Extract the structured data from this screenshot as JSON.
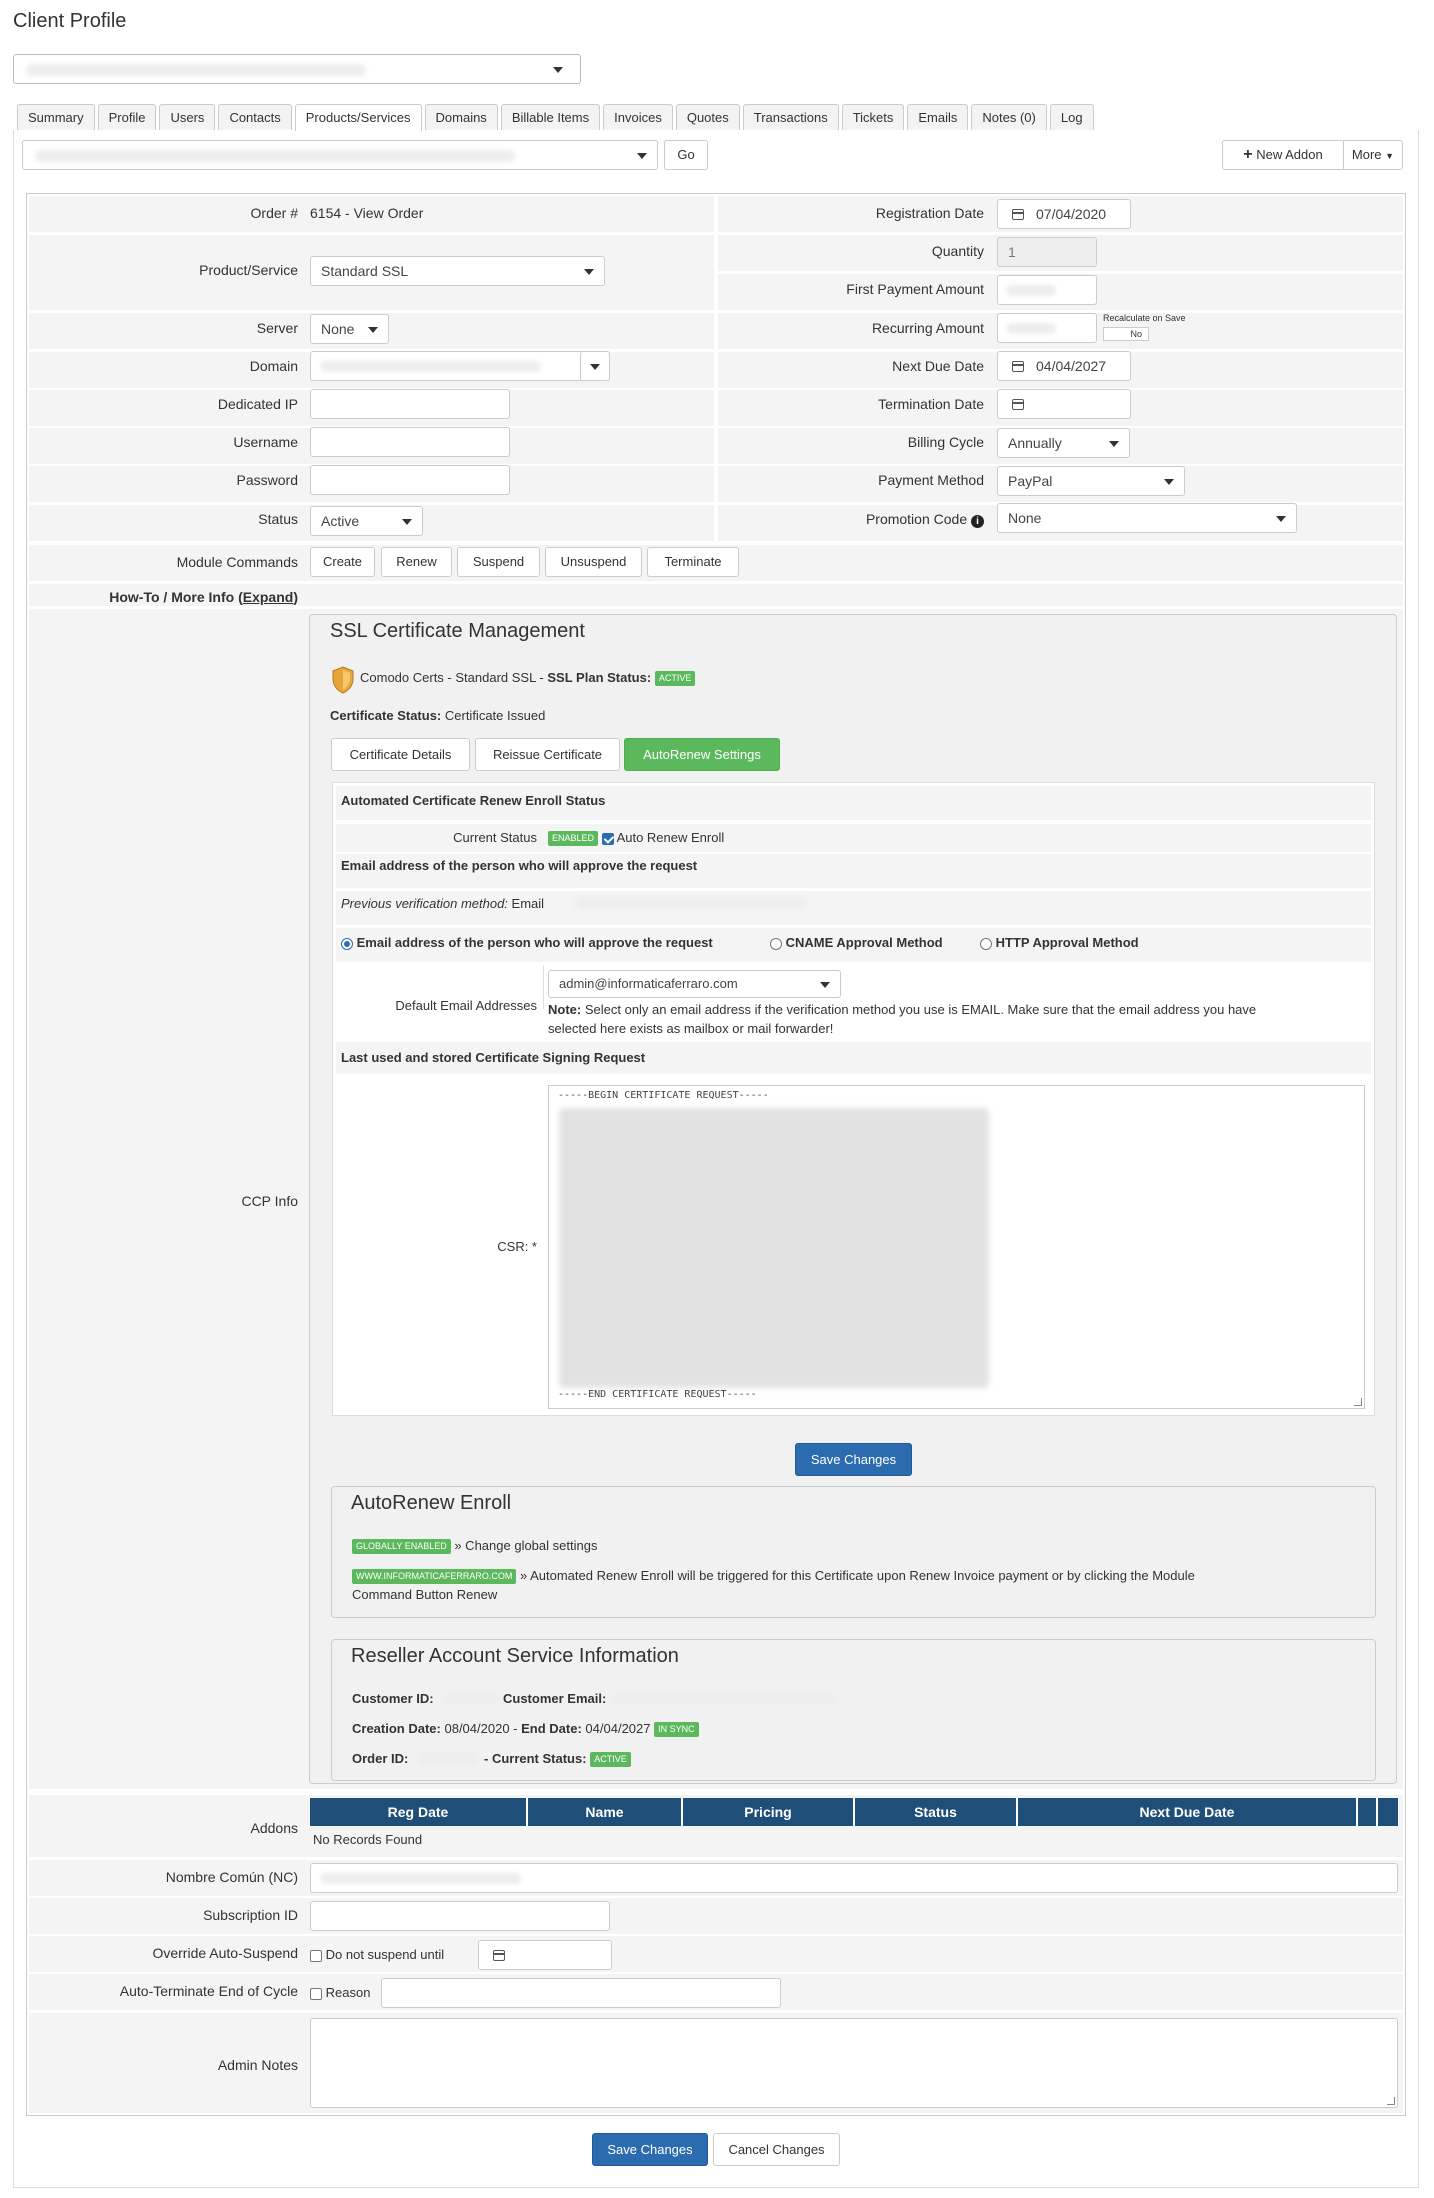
{
  "page_title": "Client Profile",
  "tabs": [
    "Summary",
    "Profile",
    "Users",
    "Contacts",
    "Products/Services",
    "Domains",
    "Billable Items",
    "Invoices",
    "Quotes",
    "Transactions",
    "Tickets",
    "Emails",
    "Notes (0)",
    "Log"
  ],
  "active_tab": "Products/Services",
  "toolbar": {
    "go": "Go",
    "new_addon": "New Addon",
    "more": "More"
  },
  "left": {
    "order_label": "Order #",
    "order_value": "6154 - View Order",
    "product_label": "Product/Service",
    "product_value": "Standard SSL",
    "server_label": "Server",
    "server_value": "None",
    "domain_label": "Domain",
    "dedicated_ip_label": "Dedicated IP",
    "username_label": "Username",
    "password_label": "Password",
    "status_label": "Status",
    "status_value": "Active",
    "module_commands_label": "Module Commands",
    "howto_label": "How-To / More Info (",
    "howto_link": "Expand",
    "howto_close": ")"
  },
  "module_commands": [
    "Create",
    "Renew",
    "Suspend",
    "Unsuspend",
    "Terminate"
  ],
  "right": {
    "reg_date_label": "Registration Date",
    "reg_date_value": "07/04/2020",
    "quantity_label": "Quantity",
    "quantity_value": "1",
    "first_payment_label": "First Payment Amount",
    "recurring_label": "Recurring Amount",
    "recalc_label": "Recalculate on Save",
    "recalc_value": "No",
    "next_due_label": "Next Due Date",
    "next_due_value": "04/04/2027",
    "termination_label": "Termination Date",
    "billing_cycle_label": "Billing Cycle",
    "billing_cycle_value": "Annually",
    "payment_method_label": "Payment Method",
    "payment_method_value": "PayPal",
    "promo_label": "Promotion Code",
    "promo_value": "None"
  },
  "ccp_info_label": "CCP Info",
  "ssl": {
    "title": "SSL Certificate Management",
    "product_line": "Comodo Certs - Standard SSL - ",
    "plan_status_label": "SSL Plan Status:",
    "plan_status_badge": "ACTIVE",
    "cert_status_label": "Certificate Status:",
    "cert_status_value": "Certificate Issued",
    "buttons": {
      "details": "Certificate Details",
      "reissue": "Reissue Certificate",
      "autorenew": "AutoRenew Settings"
    },
    "enroll_header": "Automated Certificate Renew Enroll Status",
    "current_status_label": "Current Status",
    "current_status_badge": "ENABLED",
    "auto_renew_label": "Auto Renew Enroll",
    "approver_header": "Email address of the person who will approve the request",
    "prev_method_label": "Previous verification method:",
    "prev_method_value": "Email",
    "radio_email": "Email address of the person who will approve the request",
    "radio_cname": "CNAME Approval Method",
    "radio_http": "HTTP Approval Method",
    "default_email_label": "Default Email Addresses",
    "default_email_value": "admin@informaticaferraro.com",
    "note_label": "Note:",
    "note_text": "Select only an email address if the verification method you use is EMAIL. Make sure that the email address you have",
    "note_text2": "selected here exists as mailbox or mail forwarder!",
    "csr_header": "Last used and stored Certificate Signing Request",
    "csr_label": "CSR: *",
    "csr_begin": "-----BEGIN CERTIFICATE REQUEST-----",
    "csr_end": "-----END CERTIFICATE REQUEST-----",
    "save": "Save Changes"
  },
  "autorenew": {
    "title": "AutoRenew Enroll",
    "global_badge": "GLOBALLY ENABLED",
    "global_link": "» Change global settings",
    "domain_badge": "WWW.INFORMATICAFERRARO.COM",
    "domain_text": "» Automated Renew Enroll will be triggered for this Certificate upon Renew Invoice payment or by clicking the Module",
    "domain_text2": "Command Button Renew"
  },
  "reseller": {
    "title": "Reseller Account Service Information",
    "customer_id_label": "Customer ID:",
    "customer_email_label": "Customer Email:",
    "creation_label": "Creation Date:",
    "creation_value": "08/04/2020",
    "end_label": "End Date:",
    "end_value": "04/04/2027",
    "sync_badge": "IN SYNC",
    "order_id_label": "Order ID:",
    "current_status_label": "- Current Status:",
    "status_badge": "ACTIVE"
  },
  "addons": {
    "label": "Addons",
    "columns": [
      "Reg Date",
      "Name",
      "Pricing",
      "Status",
      "Next Due Date"
    ],
    "empty": "No Records Found"
  },
  "bottom": {
    "common_name_label": "Nombre Común (NC)",
    "subscription_label": "Subscription ID",
    "override_label": "Override Auto-Suspend",
    "override_check": "Do not suspend until",
    "autoterm_label": "Auto-Terminate End of Cycle",
    "autoterm_check": "Reason",
    "notes_label": "Admin Notes"
  },
  "footer": {
    "save": "Save Changes",
    "cancel": "Cancel Changes"
  },
  "colors": {
    "primary": "#2b6cb0",
    "success": "#5cb85c",
    "table_header": "#1f4e79"
  }
}
